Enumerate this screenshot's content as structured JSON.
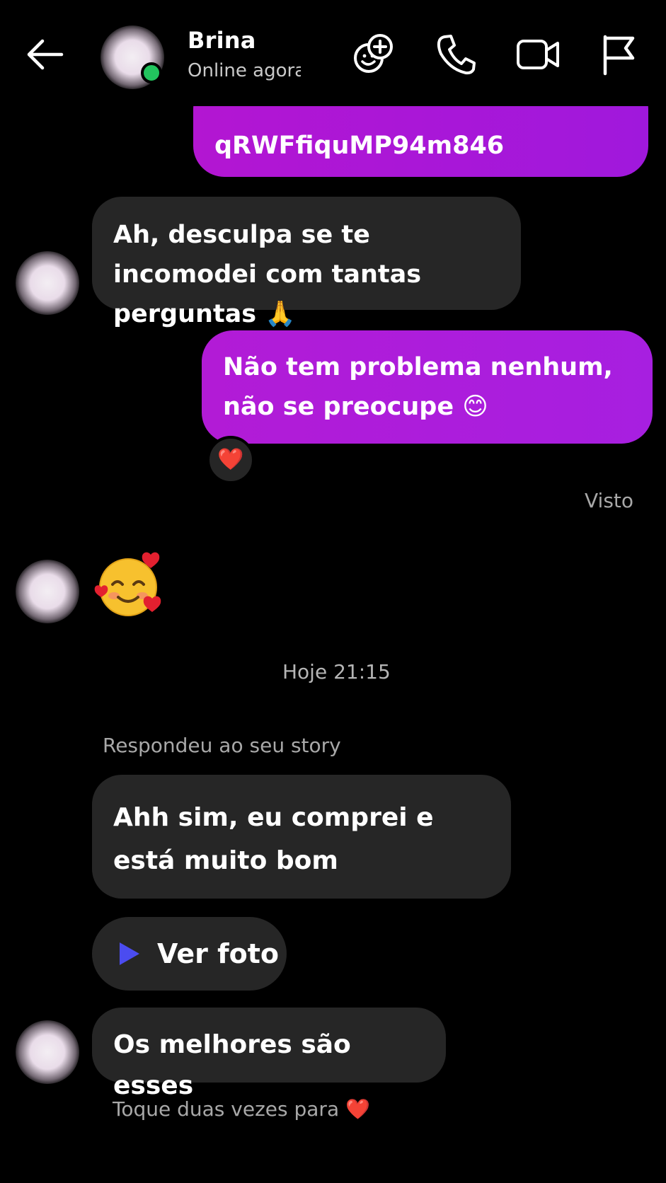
{
  "header": {
    "contact_name": "Brina",
    "status": "Online agora",
    "icons": [
      "back-arrow-icon",
      "add-effect-icon",
      "phone-icon",
      "video-camera-icon",
      "flag-icon"
    ],
    "colors": {
      "online": "#22c55e"
    }
  },
  "messages": {
    "m0": {
      "from": "me",
      "text": "qRWFfiquMP94m846"
    },
    "m1": {
      "from": "Brina",
      "text": "Ah, desculpa se te incomodei com tantas perguntas 🙏"
    },
    "m2": {
      "from": "me",
      "text": "Não tem problema nenhum, não se preocupe 😊",
      "reaction": "❤️"
    },
    "seen": "Visto",
    "m3": {
      "from": "Brina",
      "emoji": "🥰"
    },
    "timestamp": "Hoje 21:15",
    "story_reply_label": "Respondeu ao seu story",
    "m4": {
      "from": "Brina",
      "text": "Ahh sim, eu comprei e está muito bom"
    },
    "m5": {
      "from": "Brina",
      "button_label": "Ver foto"
    },
    "m6": {
      "from": "Brina",
      "text": "Os melhores são esses"
    },
    "hint": "Toque duas vezes para ❤️"
  },
  "colors": {
    "background": "#000000",
    "received_bubble": "#262626",
    "sent_bubble": "#a71fe0",
    "meta_text": "#a8a8a8",
    "play_icon": "#4b4cf0"
  }
}
